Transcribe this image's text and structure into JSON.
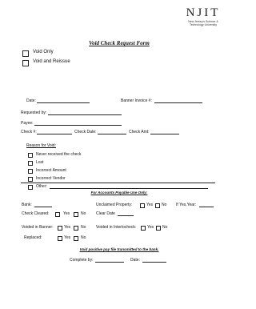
{
  "logo": {
    "text": "NJIT",
    "line1": "New Jersey's Science &",
    "line2": "Technology University"
  },
  "title": "Void Check Request Form",
  "options": [
    "Void Only",
    "Void and Reissue"
  ],
  "fields": {
    "date": "Date:",
    "banner_invoice": "Banner Invoice #:",
    "requested_by": "Requested by:",
    "payee": "Payee:",
    "check_no": "Check #:",
    "check_date": "Check Date:",
    "check_amt": "Check Amt:"
  },
  "reason": {
    "heading": "Reason for Void:",
    "items": [
      "Never received the check",
      "Lost",
      "Incorrect Amount",
      "Incorrect Vendor",
      "Other:"
    ]
  },
  "ap_section": {
    "heading": "For Accounts Payable Use Only:",
    "bank": "Bank:",
    "unclaimed": "Unclaimed Property:",
    "yes": "Yes",
    "no": "No",
    "if_yes_year": "If Yes,Year:",
    "check_cleared": "Check Cleared:",
    "clear_date": "Clear Date",
    "voided_banner": "Voided in Banner:",
    "voided_interlocheck": "Voided in Interlocheck:",
    "replaced": "Replaced:",
    "positive_pay": "Void positive pay file transmitted to the bank.",
    "completed_by": "Complete by:",
    "date": "Date:"
  }
}
